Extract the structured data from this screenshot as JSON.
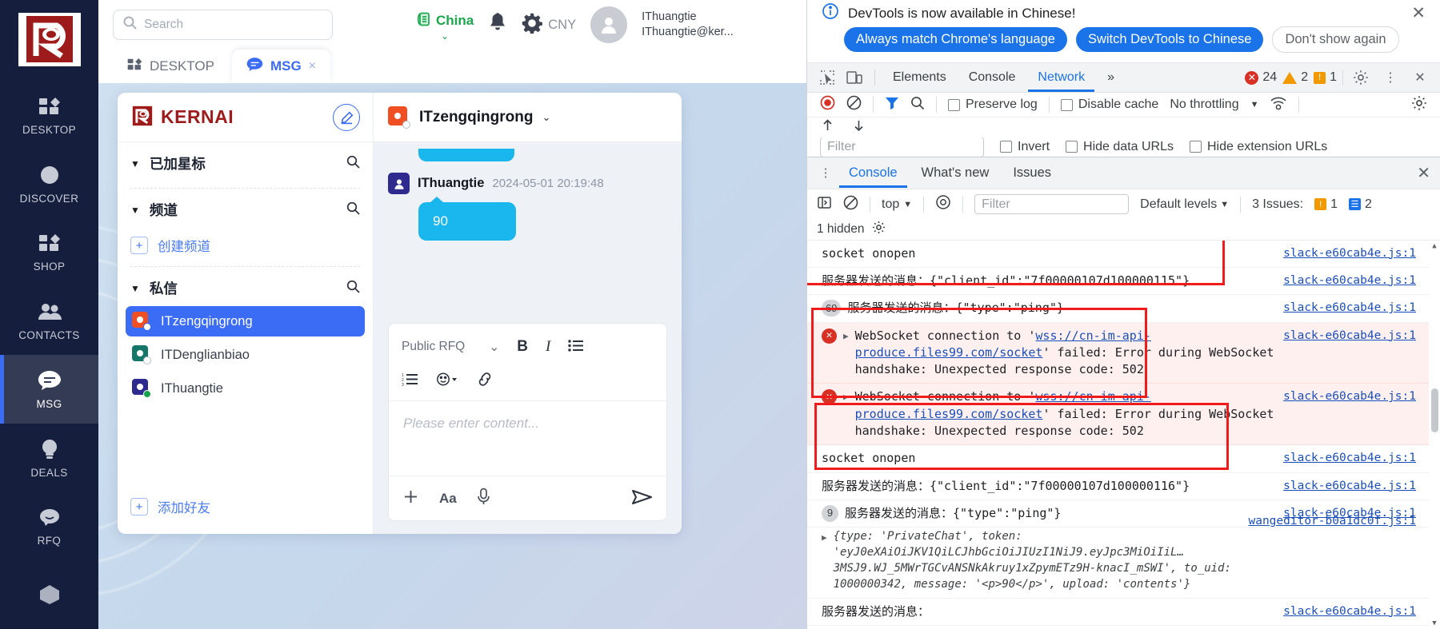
{
  "rail": {
    "logo_alt": "kernai-logo",
    "items": [
      {
        "label": "DESKTOP",
        "icon": "grid-icon",
        "active": false
      },
      {
        "label": "DISCOVER",
        "icon": "compass-icon",
        "active": false
      },
      {
        "label": "SHOP",
        "icon": "grid-icon",
        "active": false
      },
      {
        "label": "CONTACTS",
        "icon": "people-icon",
        "active": false
      },
      {
        "label": "MSG",
        "icon": "chat-icon",
        "active": true
      },
      {
        "label": "DEALS",
        "icon": "bulb-icon",
        "active": false
      },
      {
        "label": "RFQ",
        "icon": "speech-icon",
        "active": false
      }
    ]
  },
  "topbar": {
    "search_placeholder": "Search",
    "search_value": "",
    "region_label": "China",
    "currency_label": "CNY",
    "user_name": "IThuangtie",
    "user_email": "IThuangtie@ker...",
    "icons": {
      "search": "search-icon",
      "bell": "bell-icon",
      "gear": "gear-icon",
      "avatar": "avatar-icon",
      "chevron": "chevron-down-icon"
    }
  },
  "tabs": [
    {
      "label": "DESKTOP",
      "icon": "grid-icon",
      "active": false,
      "closable": false
    },
    {
      "label": "MSG",
      "icon": "chat-icon",
      "active": true,
      "closable": true,
      "close": "×"
    }
  ],
  "chatlist": {
    "brand": "KERNAI",
    "compose_icon": "compose-pencil-icon",
    "groups": [
      {
        "title": "已加星标",
        "caret": "▼",
        "search_icon": "search-icon",
        "items": []
      },
      {
        "title": "频道",
        "caret": "▼",
        "search_icon": "search-icon",
        "add_label": "创建频道",
        "add_sign": "+"
      },
      {
        "title": "私信",
        "caret": "▼",
        "search_icon": "search-icon",
        "peers": [
          {
            "name": "ITzengqingrong",
            "color": "#f04e23",
            "status": "offline",
            "selected": true
          },
          {
            "name": "ITDenglianbiao",
            "color": "#15776a",
            "status": "offline",
            "selected": false
          },
          {
            "name": "IThuangtie",
            "color": "#2e2a8e",
            "status": "online",
            "selected": false
          }
        ]
      }
    ],
    "add_friend_label": "添加好友",
    "add_friend_sign": "+"
  },
  "conversation": {
    "title": "ITzengqingrong",
    "chevron": "⌄",
    "message": {
      "sender": "IThuangtie",
      "timestamp": "2024-05-01 20:19:48",
      "text": "90"
    },
    "editor": {
      "select_value": "Public RFQ",
      "select_chevron": "⌄",
      "bold": "B",
      "italic": "I",
      "list_icon": "bullet-list-icon",
      "ordered_list_icon": "ordered-list-icon",
      "emoji_icon": "emoji-icon",
      "link_icon": "link-icon",
      "placeholder": "Please enter content...",
      "plus_icon": "plus-icon",
      "font_label": "Aa",
      "mic_icon": "microphone-icon",
      "send_icon": "send-icon"
    }
  },
  "devtools": {
    "banner": {
      "message": "DevTools is now available in Chinese!",
      "info_icon": "info-icon",
      "close_icon": "close-icon",
      "buttons": [
        {
          "label": "Always match Chrome's language",
          "primary": true
        },
        {
          "label": "Switch DevTools to Chinese",
          "primary": true
        },
        {
          "label": "Don't show again",
          "primary": false
        }
      ]
    },
    "tabs": {
      "inspect_icon": "inspect-cursor-icon",
      "device_icon": "device-toolbar-icon",
      "items": [
        {
          "label": "Elements",
          "active": false
        },
        {
          "label": "Console",
          "active": false
        },
        {
          "label": "Network",
          "active": true
        }
      ],
      "more": "»",
      "errors": "24",
      "warnings": "2",
      "infos": "1",
      "settings_icon": "gear-icon",
      "kebab_icon": "more-vertical-icon",
      "close_icon": "close-icon"
    },
    "network": {
      "record_icon": "record-icon",
      "clear_icon": "clear-icon",
      "filter_icon": "filter-icon",
      "search_icon": "search-icon",
      "preserve_log": "Preserve log",
      "disable_cache": "Disable cache",
      "throttling": "No throttling",
      "throttle_chevron": "▼",
      "wifi_icon": "wifi-settings-icon",
      "settings_icon": "gear-icon",
      "import_icon": "import-har-icon",
      "export_icon": "export-har-icon",
      "filter_placeholder": "Filter",
      "invert": "Invert",
      "hide_data_urls": "Hide data URLs",
      "hide_extension_urls": "Hide extension URLs"
    },
    "drawer": {
      "kebab_icon": "more-vertical-icon",
      "tabs": [
        {
          "label": "Console",
          "active": true
        },
        {
          "label": "What's new",
          "active": false
        },
        {
          "label": "Issues",
          "active": false
        }
      ],
      "close_icon": "close-icon",
      "toolbar": {
        "sidebar_icon": "console-sidebar-icon",
        "clear_icon": "clear-console-icon",
        "context": "top",
        "context_chevron": "▼",
        "eye_icon": "live-expression-icon",
        "filter_placeholder": "Filter",
        "levels": "Default levels",
        "levels_chevron": "▼",
        "issues_label": "3 Issues:",
        "issues_warn": "1",
        "issues_info": "2",
        "hidden_label": "1 hidden",
        "settings_icon": "gear-icon"
      },
      "logs": [
        {
          "id": "l1",
          "type": "log",
          "text": "socket onopen",
          "source": "slack-e60cab4e.js:1",
          "boxed": true
        },
        {
          "id": "l2",
          "type": "log",
          "text": "服务器发送的消息：{\"client_id\":\"7f00000107d100000115\"}",
          "source": "slack-e60cab4e.js:1",
          "boxed": true
        },
        {
          "id": "l3",
          "type": "log",
          "count": "69",
          "text": "服务器发送的消息：{\"type\":\"ping\"}",
          "source": "slack-e60cab4e.js:1",
          "boxed": false
        },
        {
          "id": "l4",
          "type": "error",
          "tri": "▶",
          "text_pre": "WebSocket connection to '",
          "link": "wss://cn-im-api-produce.files99.com/socket",
          "text_post": "' failed: Error during WebSocket handshake: Unexpected response code: 502",
          "source": "slack-e60cab4e.js:1",
          "boxed": true
        },
        {
          "id": "l5",
          "type": "error",
          "tri": "▶",
          "text_pre": "WebSocket connection to '",
          "link": "wss://cn-im-api-produce.files99.com/socket",
          "text_post": "' failed: Error during WebSocket handshake: Unexpected response code: 502",
          "source": "slack-e60cab4e.js:1",
          "boxed": true
        },
        {
          "id": "l6",
          "type": "log",
          "text": "socket onopen",
          "source": "slack-e60cab4e.js:1",
          "boxed": true
        },
        {
          "id": "l7",
          "type": "log",
          "text": "服务器发送的消息：{\"client_id\":\"7f00000107d100000116\"}",
          "source": "slack-e60cab4e.js:1",
          "boxed": true
        },
        {
          "id": "l8",
          "type": "log",
          "count": "9",
          "text": "服务器发送的消息：{\"type\":\"ping\"}",
          "source": "slack-e60cab4e.js:1",
          "boxed": true
        },
        {
          "id": "l9",
          "type": "object",
          "tri": "▶",
          "source": "wangeditor-b0a1dc0f.js:1",
          "text": "{type: 'PrivateChat', token: 'eyJ0eXAiOiJKV1QiLCJhbGciOiJIUzI1NiJ9.eyJpc3MiOiIiL…3MSJ9.WJ_5MWrTGCvANSNkAkruy1xZpymETz9H-knacI_mSWI', to_uid: 1000000342, message: '<p>90</p>', upload: 'contents'}"
        },
        {
          "id": "l10",
          "type": "log",
          "text": "服务器发送的消息：",
          "source": "slack-e60cab4e.js:1",
          "boxed": false
        }
      ]
    }
  }
}
